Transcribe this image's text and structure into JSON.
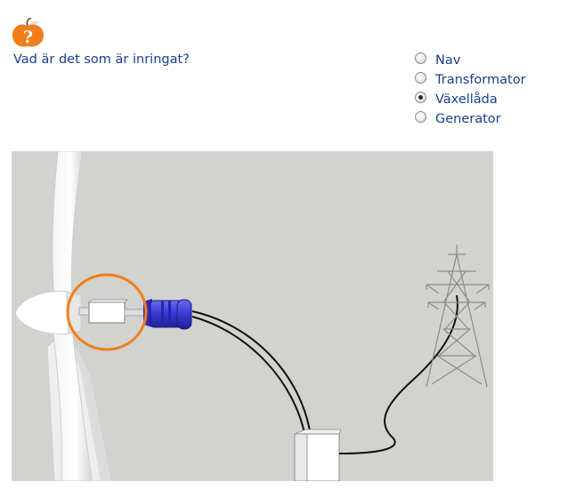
{
  "question": {
    "text": "Vad är det som är inringat?"
  },
  "options": [
    {
      "label": "Nav",
      "checked": false
    },
    {
      "label": "Transformator",
      "checked": false
    },
    {
      "label": "Växellåda",
      "checked": true
    },
    {
      "label": "Generator",
      "checked": false
    }
  ],
  "colors": {
    "text": "#1b3f8c",
    "highlight_circle": "#f07f1b",
    "generator": "#3b3bd6",
    "diagram_background": "#d2d2cf"
  },
  "icons": {
    "quiz": "orange-question-apple-icon"
  }
}
